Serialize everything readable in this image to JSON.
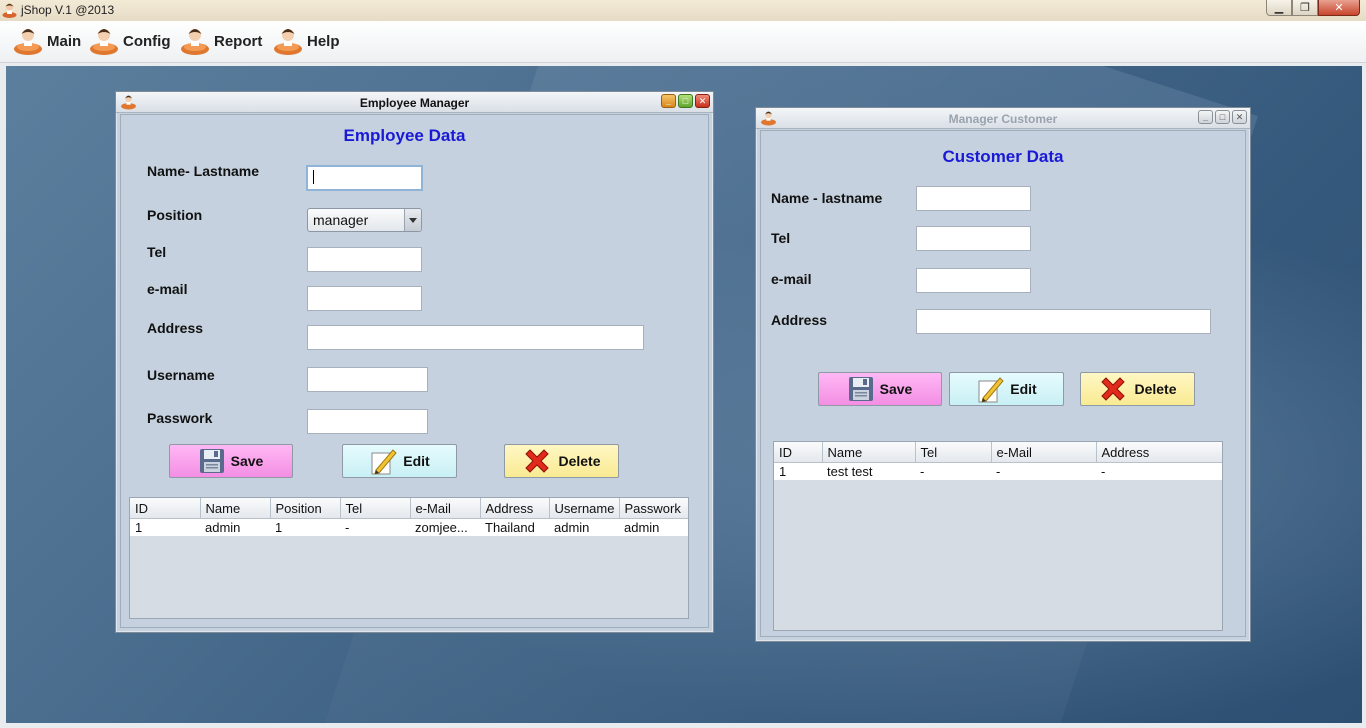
{
  "app": {
    "title": "jShop V.1 @2013",
    "window_controls": {
      "minimize": "▁",
      "restore": "❐",
      "close": "✕"
    }
  },
  "menu": {
    "items": [
      {
        "label": "Main",
        "icon": "user-icon"
      },
      {
        "label": "Config",
        "icon": "user-icon"
      },
      {
        "label": "Report",
        "icon": "user-icon"
      },
      {
        "label": "Help",
        "icon": "user-icon"
      }
    ]
  },
  "employee_frame": {
    "title": "Employee Manager",
    "heading": "Employee Data",
    "labels": {
      "name": "Name- Lastname",
      "position": "Position",
      "tel": "Tel",
      "email": "e-mail",
      "address": "Address",
      "username": "Username",
      "password": "Passwork"
    },
    "values": {
      "name": "",
      "position": "manager",
      "tel": "",
      "email": "",
      "address": "",
      "username": "",
      "password": ""
    },
    "buttons": {
      "save": "Save",
      "edit": "Edit",
      "delete": "Delete"
    },
    "table": {
      "columns": [
        "ID",
        "Name",
        "Position",
        "Tel",
        "e-Mail",
        "Address",
        "Username",
        "Passwork"
      ],
      "rows": [
        [
          "1",
          "admin",
          "1",
          "-",
          "zomjee...",
          "Thailand",
          "admin",
          "admin"
        ]
      ]
    }
  },
  "customer_frame": {
    "title": "Manager Customer",
    "heading": "Customer Data",
    "labels": {
      "name": "Name - lastname",
      "tel": "Tel",
      "email": "e-mail",
      "address": "Address"
    },
    "values": {
      "name": "",
      "tel": "",
      "email": "",
      "address": ""
    },
    "buttons": {
      "save": "Save",
      "edit": "Edit",
      "delete": "Delete"
    },
    "table": {
      "columns": [
        "ID",
        "Name",
        "Tel",
        "e-Mail",
        "Address"
      ],
      "rows": [
        [
          "1",
          "test test",
          "-",
          "-",
          "-"
        ]
      ]
    }
  },
  "colors": {
    "heading": "#1a1ad6",
    "save_button": "#f38ee4",
    "edit_button": "#c8f0f5",
    "delete_button": "#f9ea93",
    "desktop": "#3d5f82"
  }
}
